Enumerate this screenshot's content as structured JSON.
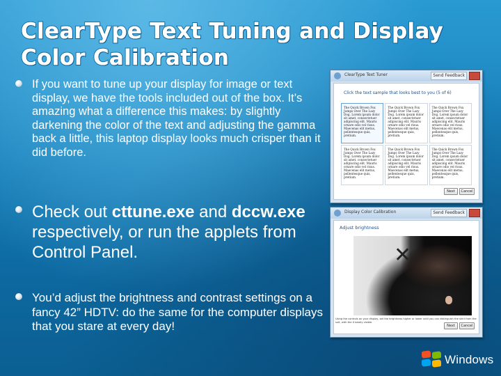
{
  "slide": {
    "title_line1": "ClearType Text Tuning and Display",
    "title_line2": "Color Calibration",
    "bullets": [
      "If you want to tune up your display for image or text display, we have the tools included out of the box. It’s amazing what a difference this makes: by slightly darkening the color of the text and adjusting the gamma back a little, this laptop display looks much crisper than it did before.",
      {
        "prefix": "Check out ",
        "cmd1": "cttune.exe",
        "mid": " and ",
        "cmd2": "dccw.exe",
        "suffix": " respectively, or run the applets from Control Panel."
      },
      "You’d adjust the brightness and contrast settings on a fancy 42” HDTV: do the same for the computer displays that you stare at every day!"
    ]
  },
  "screenshot_cleartype": {
    "window_title": "ClearType Text Tuner",
    "send_feedback": "Send Feedback",
    "instruction": "Click the text sample that looks best to you (5 of 6)",
    "sample_text": "The Quick Brown Fox Jumps Over The Lazy Dog. Lorem ipsum dolor sit amet, consectetuer adipiscing elit. Mauris ornare odio vel risus. Maecenas elit metus, pellentesque quis, pretium.",
    "next_label": "Next",
    "cancel_label": "Cancel"
  },
  "screenshot_calibration": {
    "window_title": "Display Color Calibration",
    "send_feedback": "Send Feedback",
    "heading": "Adjust brightness",
    "caption": "Using the controls on your display, set the brightness higher or lower until you can distinguish the shirt from the suit, with the X barely visible.",
    "next_label": "Next",
    "cancel_label": "Cancel"
  },
  "brand": {
    "logo_text": "Windows"
  }
}
